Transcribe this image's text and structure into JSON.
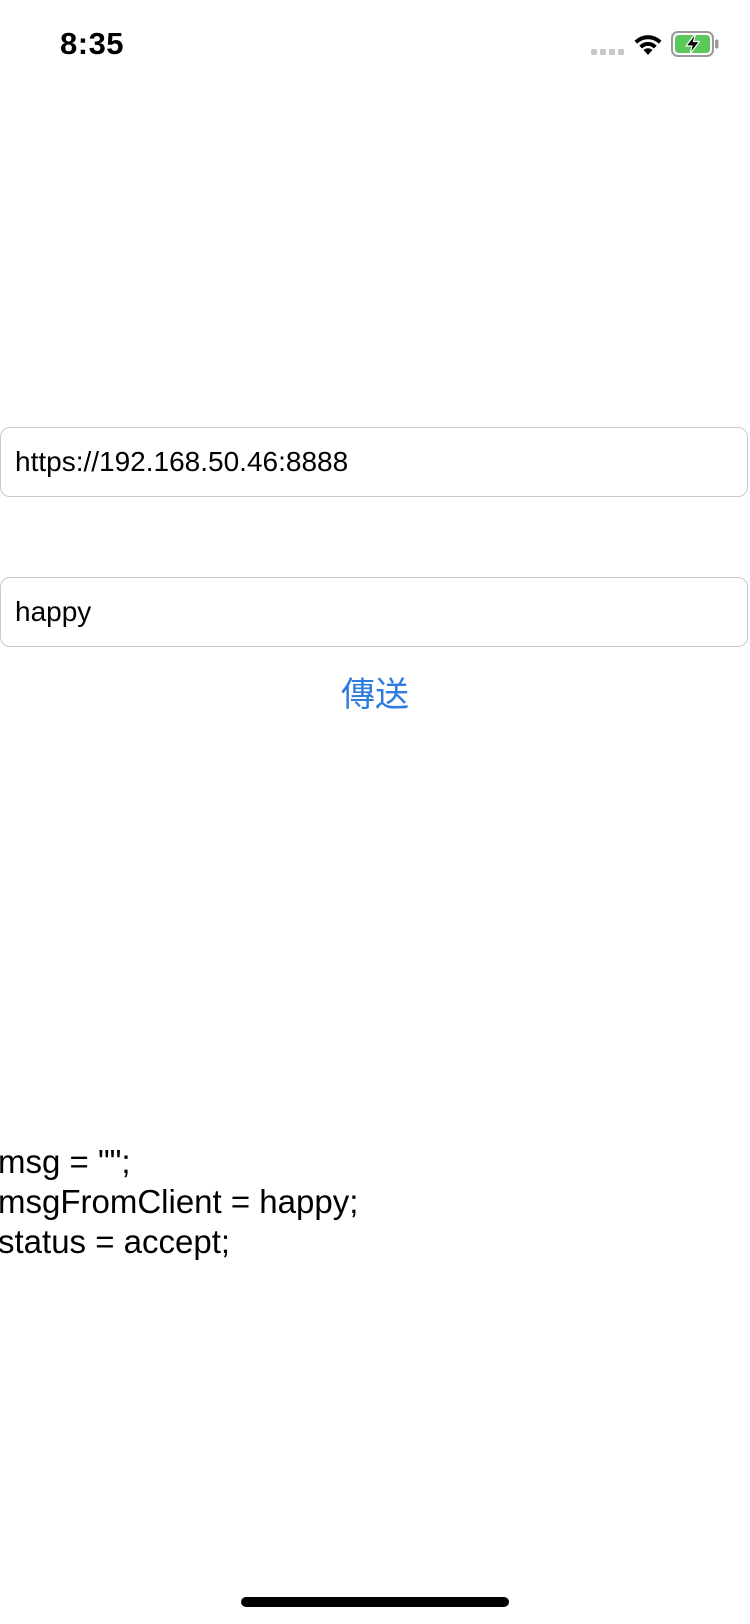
{
  "status_bar": {
    "time": "8:35",
    "icons": [
      "cellular-signal-icon",
      "wifi-icon",
      "battery-charging-icon"
    ],
    "battery_color": "#5ac85a"
  },
  "form": {
    "url_field": {
      "value": "https://192.168.50.46:8888"
    },
    "message_field": {
      "value": "happy"
    },
    "send_button_label": "傳送"
  },
  "log": {
    "lines": [
      "msg = \"\";",
      "msgFromClient = happy;",
      "status = accept;"
    ]
  },
  "colors": {
    "accent": "#2f7ce0",
    "field_border": "#c9c9cc",
    "background": "#ffffff"
  }
}
